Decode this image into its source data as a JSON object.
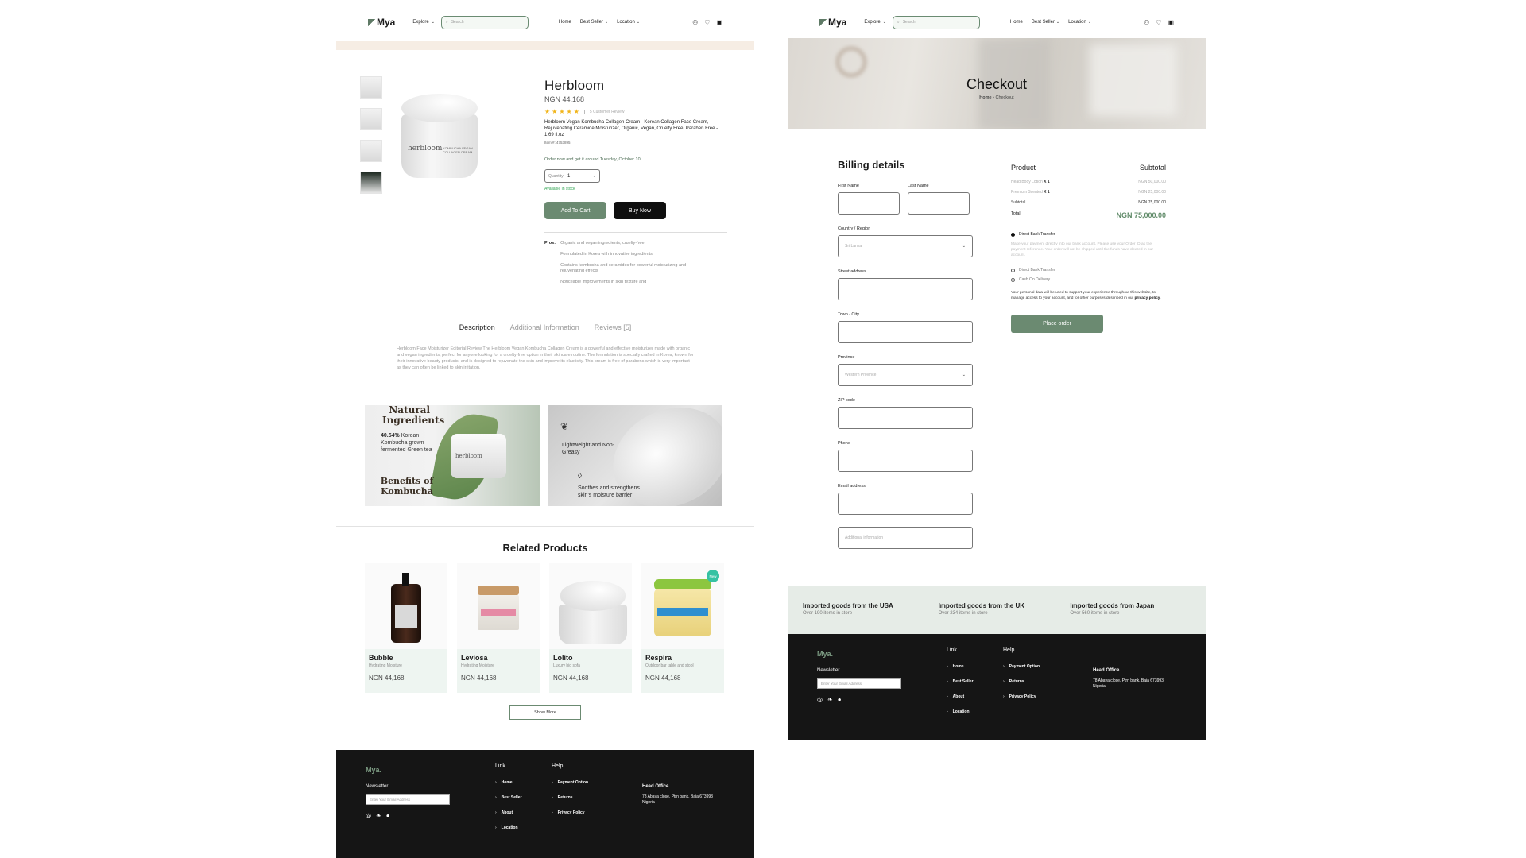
{
  "header": {
    "logo": "Mya",
    "explore": "Explore",
    "search_placeholder": "Search",
    "links": [
      "Home",
      "Best Seller",
      "Location"
    ]
  },
  "product": {
    "title": "Herbloom",
    "price": "NGN 44,168",
    "stars": "★★★★★",
    "rating_value": 4.5,
    "review_count": "5 Customer Review",
    "description": "Herbloom Vegan Kombucha Collagen Cream - Korean Collagen Face Cream, Rejuvenating Ceramide Moisturizer, Organic, Vegan, Cruelty Free, Paraben Free - 1.69 fl.oz",
    "sku": "Item #: 4753895",
    "delivery": "Order now and get it around Tuesday, October 10",
    "qty_label": "Quantity:",
    "qty_value": "1",
    "stock": "Available in stock",
    "add_to_cart": "Add To Cart",
    "buy_now": "Buy Now",
    "pros_label": "Pros:",
    "pros": [
      "Organic and vegan ingredients; cruelty-free",
      "Formulated in Korea with innovative ingredients",
      "Contains kombucha and ceramides for powerful moisturizing and rejuvenating effects",
      "Noticeable improvements in skin texture and"
    ],
    "jar_label": "herbloom",
    "jar_side": "KOMBUCHA VEGAN COLLAGEN CREAM"
  },
  "tabs": [
    "Description",
    "Additional Information",
    "Reviews [5]"
  ],
  "description_text": "Herbloom Face Moisturizer Editorial Review The Herbloom Vegan Kombucha Collagen Cream is a powerful and effective moisturizer made with organic and vegan ingredients, perfect for anyone looking for a cruelty-free option in their skincare routine. The formulation is specially crafted in Korea, known for their innovative beauty products, and is designed to rejuvenate the skin and improve its elasticity. This cream is free of parabens which is very important as they can often be linked to skin irritation.",
  "banner1": {
    "title": "Natural Ingredients",
    "stat_pct": "40.54%",
    "stat_text": "Korean Kombucha grown fermented Green tea",
    "bottom_title": "Benefits of Kombucha",
    "jar_label": "herbloom"
  },
  "banner2": {
    "text1": "Lightweight and Non-Greasy",
    "text2": "Soothes and strengthens skin's moisture barrier"
  },
  "related": {
    "title": "Related Products",
    "items": [
      {
        "name": "Bubble",
        "sub": "Hydrating Moisture",
        "price": "NGN 44,168"
      },
      {
        "name": "Leviosa",
        "sub": "Hydrating Moisture",
        "price": "NGN 44,168"
      },
      {
        "name": "Lolito",
        "sub": "Luxury big sofa",
        "price": "NGN 44,168"
      },
      {
        "name": "Respira",
        "sub": "Outdoor bar table and stool",
        "price": "NGN 44,168",
        "badge": "New"
      }
    ],
    "show_more": "Show More"
  },
  "footer": {
    "logo": "Mya.",
    "newsletter": "Newsletter",
    "email_placeholder": "Enter Your Email Address",
    "link_title": "Link",
    "links": [
      "Home",
      "Best Seller",
      "About",
      "Location"
    ],
    "help_title": "Help",
    "help": [
      "Payment Option",
      "Returns",
      "Privacy Policy"
    ],
    "office_title": "Head Office",
    "office_address": "78 Abaya close, Ptrn bank, Baja 673993 Nigeria"
  },
  "checkout": {
    "title": "Checkout",
    "crumb_home": "Home",
    "crumb_current": "Checkout",
    "billing_title": "Billing details",
    "first_name": "First Name",
    "last_name": "Last Name",
    "country_label": "Country / Region",
    "country_value": "Sri Lanka",
    "street_label": "Street address",
    "town_label": "Town / City",
    "province_label": "Province",
    "province_value": "Western Province",
    "zip_label": "ZIP code",
    "phone_label": "Phone",
    "email_label": "Email address",
    "additional_placeholder": "Additional information",
    "order": {
      "product_hdr": "Product",
      "subtotal_hdr": "Subtotal",
      "rows": [
        {
          "name": "Head Body Lotion",
          "qty": "X 1",
          "price": "NGN 50,000.00"
        },
        {
          "name": "Premium Scented",
          "qty": "X 1",
          "price": "NGN 25,000.00"
        }
      ],
      "subtotal_label": "Subtotal",
      "subtotal_value": "NGN 75,000.00",
      "total_label": "Total",
      "total_value": "NGN 75,000.00"
    },
    "pay_bank": "Direct Bank Transfer",
    "pay_note": "Make your payment directly into our bank account. Please use your Order ID as the payment reference. Your order will not be shipped until the funds have cleared in our account.",
    "pay_opt1": "Direct Bank Transfer",
    "pay_opt2": "Cash On Delivery",
    "privacy_text": "Your personal data will be used to support your experience throughout this website, to manage access to your account, and for other purposes described in our",
    "privacy_link": "privacy policy.",
    "place_order": "Place order",
    "imports": [
      {
        "title": "Imported goods from the USA",
        "sub": "Over 190 items in store"
      },
      {
        "title": "Imported goods from the UK",
        "sub": "Over 234 items in store"
      },
      {
        "title": "Imported goods from Japan",
        "sub": "Over 560 items in store"
      }
    ]
  }
}
